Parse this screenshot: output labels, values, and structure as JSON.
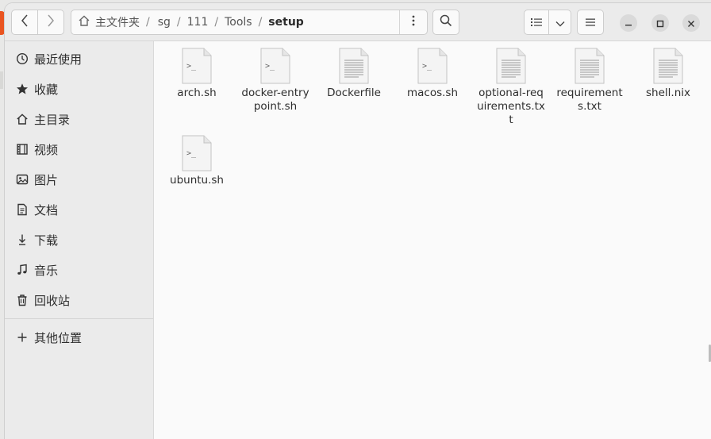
{
  "window": {
    "path": {
      "home": "主文件夹",
      "segments": [
        "sg",
        "111",
        "Tools"
      ],
      "current": "setup"
    }
  },
  "sidebar": {
    "items": [
      {
        "label": "最近使用",
        "icon": "clock-icon"
      },
      {
        "label": "收藏",
        "icon": "star-icon"
      },
      {
        "label": "主目录",
        "icon": "home-icon"
      },
      {
        "label": "视频",
        "icon": "film-icon"
      },
      {
        "label": "图片",
        "icon": "image-icon"
      },
      {
        "label": "文档",
        "icon": "document-icon"
      },
      {
        "label": "下载",
        "icon": "download-icon"
      },
      {
        "label": "音乐",
        "icon": "music-icon"
      },
      {
        "label": "回收站",
        "icon": "trash-icon"
      }
    ],
    "other": {
      "label": "其他位置",
      "icon": "plus-icon"
    }
  },
  "files": [
    {
      "name": "arch.sh",
      "type": "script"
    },
    {
      "name": "docker-entrypoint.sh",
      "type": "script"
    },
    {
      "name": "Dockerfile",
      "type": "text"
    },
    {
      "name": "macos.sh",
      "type": "script"
    },
    {
      "name": "optional-requirements.txt",
      "type": "text"
    },
    {
      "name": "requirements.txt",
      "type": "text"
    },
    {
      "name": "shell.nix",
      "type": "text"
    },
    {
      "name": "ubuntu.sh",
      "type": "script"
    }
  ],
  "colors": {
    "accent": "#e95420",
    "header": "#ebebeb",
    "content": "#fafafa"
  }
}
